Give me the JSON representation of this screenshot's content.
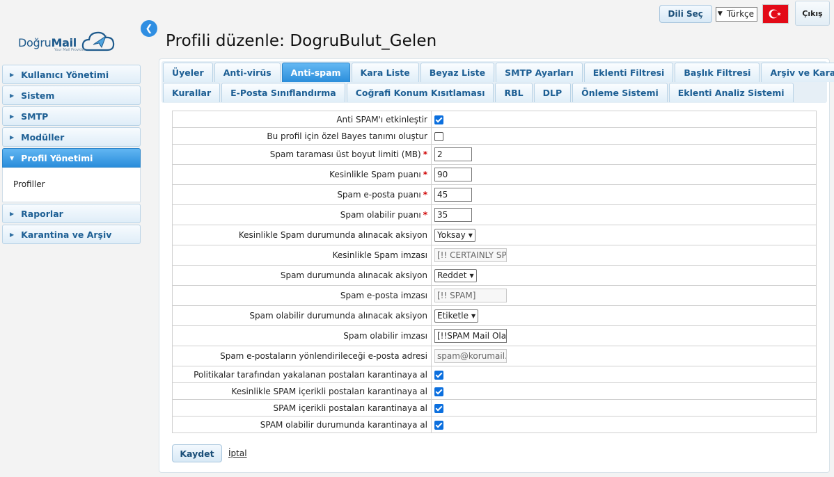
{
  "topbar": {
    "language_button": "Dili Seç",
    "language_selected": "Türkçe",
    "exit_button": "Çıkış"
  },
  "brand": {
    "name_part1": "Doğru",
    "name_part2": "Mail",
    "tagline": "Your Mail Provider"
  },
  "sidebar": {
    "items": [
      {
        "label": "Kullanıcı Yönetimi"
      },
      {
        "label": "Sistem"
      },
      {
        "label": "SMTP"
      },
      {
        "label": "Modüller"
      },
      {
        "label": "Profil Yönetimi"
      },
      {
        "label": "Raporlar"
      },
      {
        "label": "Karantina ve Arşiv"
      }
    ],
    "active_subitem": "Profiller"
  },
  "page": {
    "title": "Profili düzenle: DogruBulut_Gelen"
  },
  "tabs": {
    "row1": [
      "Üyeler",
      "Anti-virüs",
      "Anti-spam",
      "Kara Liste",
      "Beyaz Liste",
      "SMTP Ayarları",
      "Eklenti Filtresi",
      "Başlık Filtresi",
      "Arşiv ve Karantina"
    ],
    "row2": [
      "Kurallar",
      "E-Posta Sınıflandırma",
      "Coğrafi Konum Kısıtlaması",
      "RBL",
      "DLP",
      "Önleme Sistemi",
      "Eklenti Analiz Sistemi"
    ],
    "active": "Anti-spam"
  },
  "form": {
    "rows": [
      {
        "label": "Anti SPAM'ı etkinleştir",
        "type": "checkbox",
        "checked": true
      },
      {
        "label": "Bu profil için özel Bayes tanımı oluştur",
        "type": "checkbox",
        "checked": false
      },
      {
        "label": "Spam taraması üst boyut limiti (MB)",
        "required": "*",
        "type": "text",
        "value": "2"
      },
      {
        "label": "Kesinlikle Spam puanı",
        "required": "*",
        "type": "text",
        "value": "90"
      },
      {
        "label": "Spam e-posta puanı",
        "required": "*",
        "type": "text",
        "value": "45"
      },
      {
        "label": "Spam olabilir puanı",
        "required": "*",
        "type": "text",
        "value": "35"
      },
      {
        "label": "Kesinlikle Spam durumunda alınacak aksiyon",
        "type": "select",
        "value": "Yoksay"
      },
      {
        "label": "Kesinlikle Spam imzası",
        "type": "text-disabled",
        "value": "[!! CERTAINLY SPA"
      },
      {
        "label": "Spam durumunda alınacak aksiyon",
        "type": "select",
        "value": "Reddet"
      },
      {
        "label": "Spam e-posta imzası",
        "type": "text-disabled",
        "value": "[!! SPAM]"
      },
      {
        "label": "Spam olabilir durumunda alınacak aksiyon",
        "type": "select",
        "value": "Etiketle"
      },
      {
        "label": "Spam olabilir imzası",
        "type": "text",
        "value": "[!!SPAM Mail Olab"
      },
      {
        "label": "Spam e-postaların yönlendirileceği e-posta adresi",
        "type": "text-disabled",
        "value": "spam@korumail.com"
      },
      {
        "label": "Politikalar tarafından yakalanan postaları karantinaya al",
        "type": "checkbox",
        "checked": true
      },
      {
        "label": "Kesinlikle SPAM içerikli postaları karantinaya al",
        "type": "checkbox",
        "checked": true
      },
      {
        "label": "SPAM içerikli postaları karantinaya al",
        "type": "checkbox",
        "checked": true
      },
      {
        "label": "SPAM olabilir durumunda karantinaya al",
        "type": "checkbox",
        "checked": true
      }
    ],
    "save_button": "Kaydet",
    "cancel_link": "İptal"
  },
  "colors": {
    "accent": "#2b8edb",
    "nav_text": "#1d5f94",
    "required": "#d00000",
    "checkbox": "#0b6fde"
  }
}
